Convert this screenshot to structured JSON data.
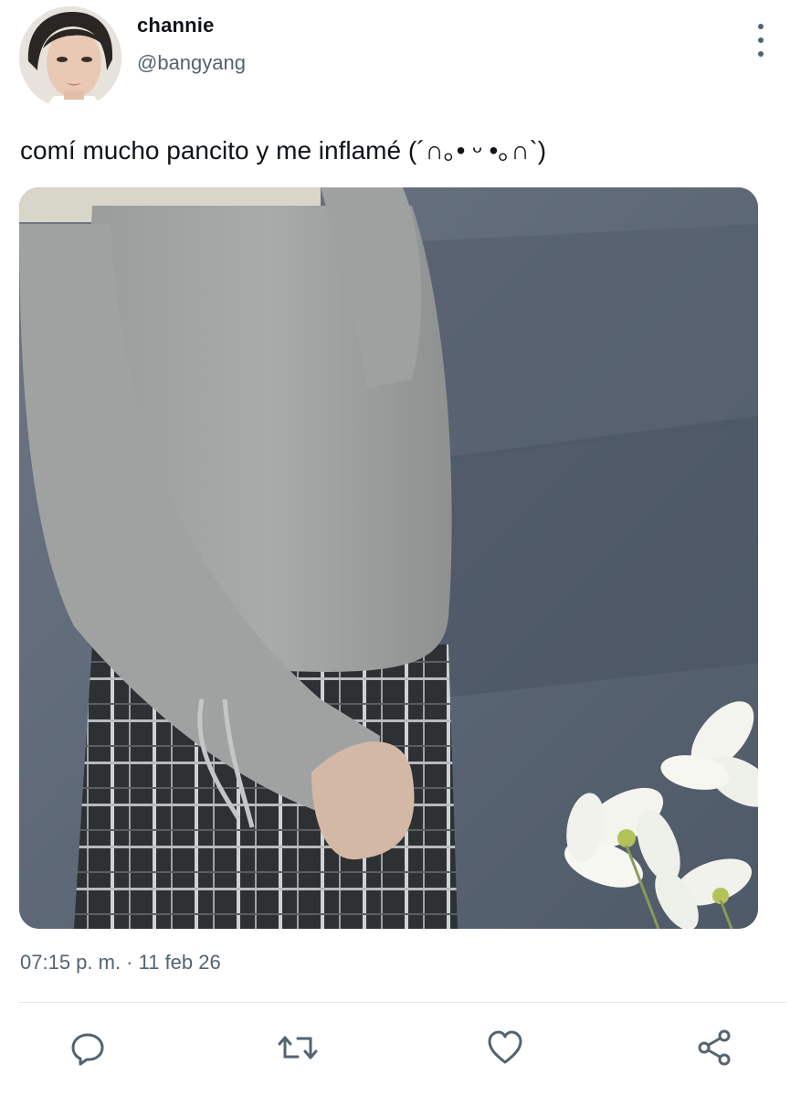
{
  "user": {
    "display_name": "channie",
    "handle": "@bangyang",
    "avatar_icon": "avatar"
  },
  "post": {
    "text": "comí mucho pancito y me inflamé (´∩｡• ᵕ •｡∩`)",
    "timestamp": "07:15 p. m. · 11 feb 26",
    "media_icon": "photo"
  },
  "actions": [
    {
      "icon": "reply-icon"
    },
    {
      "icon": "repost-icon"
    },
    {
      "icon": "like-icon"
    },
    {
      "icon": "share-icon"
    }
  ],
  "colors": {
    "text_primary": "#0f1419",
    "text_secondary": "#536471",
    "divider": "#e1e6ea"
  }
}
